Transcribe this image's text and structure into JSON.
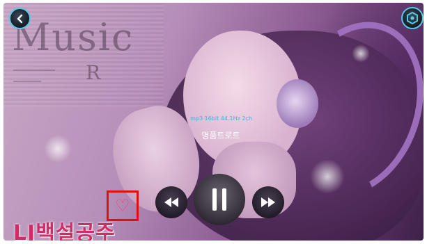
{
  "background": {
    "logo_word": "Music",
    "logo_letter": "R"
  },
  "track": {
    "meta": "mp3 16bit 44.1Hz 2ch",
    "title": "명품트로트"
  },
  "album_banner": {
    "text": "LJ백설공주"
  },
  "icons": {
    "back": "chevron-left-icon",
    "settings": "hexagon-settings-icon",
    "favorite": "heart-outline-icon",
    "previous": "rewind-icon",
    "pause": "pause-icon",
    "next": "fast-forward-icon"
  },
  "colors": {
    "accent": "#2cb6e4",
    "highlight_box": "#e01010",
    "heart": "#ff3f6e",
    "banner_text": "#d12c66"
  }
}
